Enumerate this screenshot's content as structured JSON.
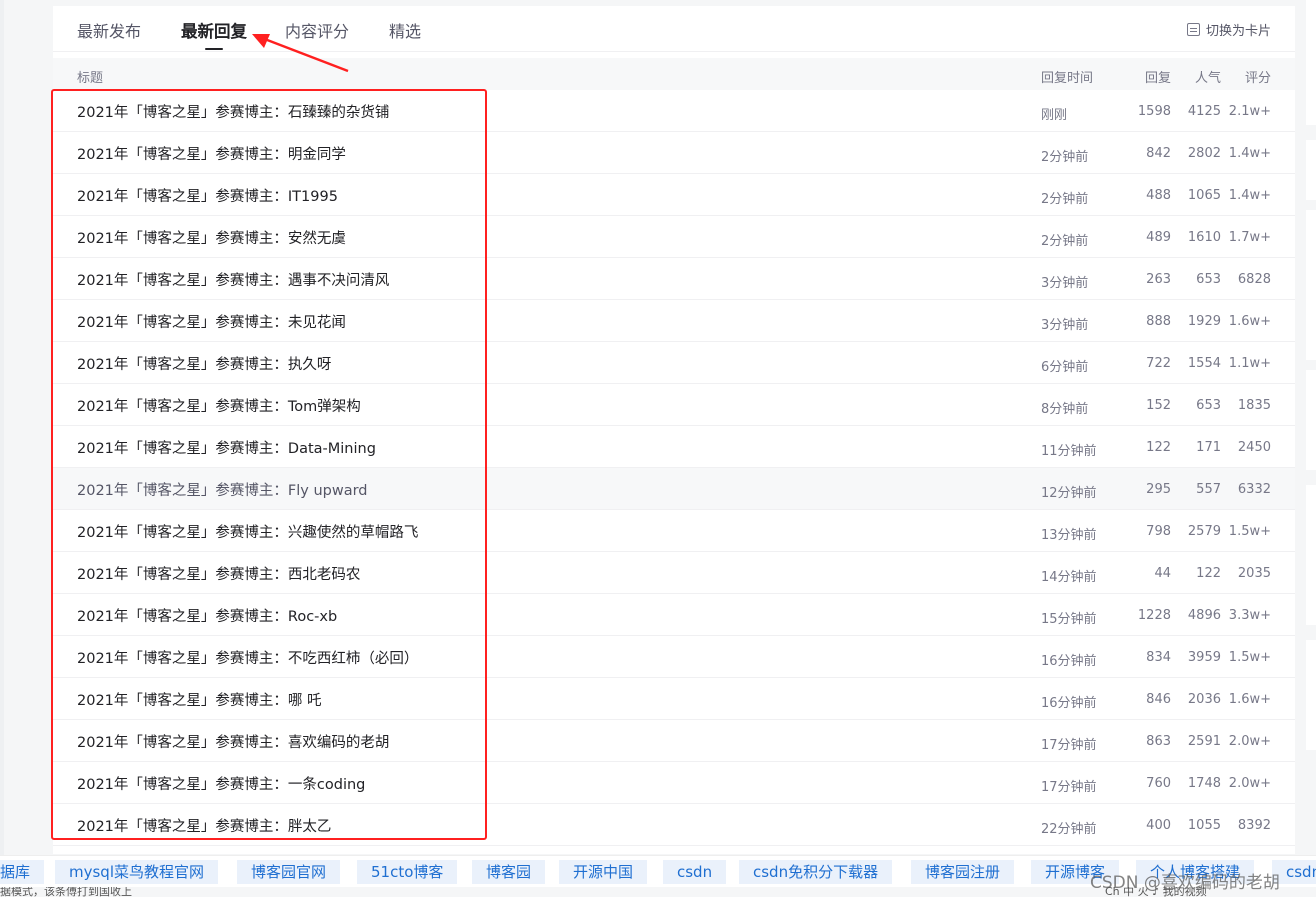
{
  "tabs": [
    {
      "label": "最新发布"
    },
    {
      "label": "最新回复"
    },
    {
      "label": "内容评分"
    },
    {
      "label": "精选"
    }
  ],
  "switch_view_label": "切换为卡片",
  "table_header": {
    "title": "标题",
    "reply_time": "回复时间",
    "replies": "回复",
    "popularity": "人气",
    "score": "评分"
  },
  "rows": [
    {
      "title": "2021年「博客之星」参赛博主：石臻臻的杂货铺",
      "time": "刚刚",
      "replies": "1598",
      "popularity": "4125",
      "score": "2.1w+"
    },
    {
      "title": "2021年「博客之星」参赛博主：明金同学",
      "time": "2分钟前",
      "replies": "842",
      "popularity": "2802",
      "score": "1.4w+"
    },
    {
      "title": "2021年「博客之星」参赛博主：IT1995",
      "time": "2分钟前",
      "replies": "488",
      "popularity": "1065",
      "score": "1.4w+"
    },
    {
      "title": "2021年「博客之星」参赛博主：安然无虞",
      "time": "2分钟前",
      "replies": "489",
      "popularity": "1610",
      "score": "1.7w+"
    },
    {
      "title": "2021年「博客之星」参赛博主：遇事不决问清风",
      "time": "3分钟前",
      "replies": "263",
      "popularity": "653",
      "score": "6828"
    },
    {
      "title": "2021年「博客之星」参赛博主：未见花闻",
      "time": "3分钟前",
      "replies": "888",
      "popularity": "1929",
      "score": "1.6w+"
    },
    {
      "title": "2021年「博客之星」参赛博主：执久呀",
      "time": "6分钟前",
      "replies": "722",
      "popularity": "1554",
      "score": "1.1w+"
    },
    {
      "title": "2021年「博客之星」参赛博主：Tom弹架构",
      "time": "8分钟前",
      "replies": "152",
      "popularity": "653",
      "score": "1835"
    },
    {
      "title": "2021年「博客之星」参赛博主：Data-Mining",
      "time": "11分钟前",
      "replies": "122",
      "popularity": "171",
      "score": "2450"
    },
    {
      "title": "2021年「博客之星」参赛博主：Fly upward",
      "time": "12分钟前",
      "replies": "295",
      "popularity": "557",
      "score": "6332"
    },
    {
      "title": "2021年「博客之星」参赛博主：兴趣使然的草帽路飞",
      "time": "13分钟前",
      "replies": "798",
      "popularity": "2579",
      "score": "1.5w+"
    },
    {
      "title": "2021年「博客之星」参赛博主：西北老码农",
      "time": "14分钟前",
      "replies": "44",
      "popularity": "122",
      "score": "2035"
    },
    {
      "title": "2021年「博客之星」参赛博主：Roc-xb",
      "time": "15分钟前",
      "replies": "1228",
      "popularity": "4896",
      "score": "3.3w+"
    },
    {
      "title": "2021年「博客之星」参赛博主：不吃西红柿（必回）",
      "time": "16分钟前",
      "replies": "834",
      "popularity": "3959",
      "score": "1.5w+"
    },
    {
      "title": "2021年「博客之星」参赛博主：哪 吒",
      "time": "16分钟前",
      "replies": "846",
      "popularity": "2036",
      "score": "1.6w+"
    },
    {
      "title": "2021年「博客之星」参赛博主：喜欢编码的老胡",
      "time": "17分钟前",
      "replies": "863",
      "popularity": "2591",
      "score": "2.0w+"
    },
    {
      "title": "2021年「博客之星」参赛博主：一条coding",
      "time": "17分钟前",
      "replies": "760",
      "popularity": "1748",
      "score": "2.0w+"
    },
    {
      "title": "2021年「博客之星」参赛博主：胖太乙",
      "time": "22分钟前",
      "replies": "400",
      "popularity": "1055",
      "score": "8392"
    }
  ],
  "links": [
    {
      "label": "据库"
    },
    {
      "label": "mysql菜鸟教程官网"
    },
    {
      "label": "博客园官网"
    },
    {
      "label": "51cto博客"
    },
    {
      "label": "博客园"
    },
    {
      "label": "开源中国"
    },
    {
      "label": "csdn"
    },
    {
      "label": "csdn免积分下载器"
    },
    {
      "label": "博客园注册"
    },
    {
      "label": "开源博客"
    },
    {
      "label": "个人博客搭建"
    },
    {
      "label": "csdn"
    }
  ],
  "bottom_bar": {
    "left_text": "据模式，该条傅打到国收上",
    "right_text": "Ch 中 火 ♪ 我的视频"
  },
  "watermark": "CSDN @喜欢编码的老胡",
  "colors": {
    "annotation_red": "#ff2020",
    "link_blue": "#1f6fd1",
    "link_chip_bg": "#eaf1fb"
  }
}
